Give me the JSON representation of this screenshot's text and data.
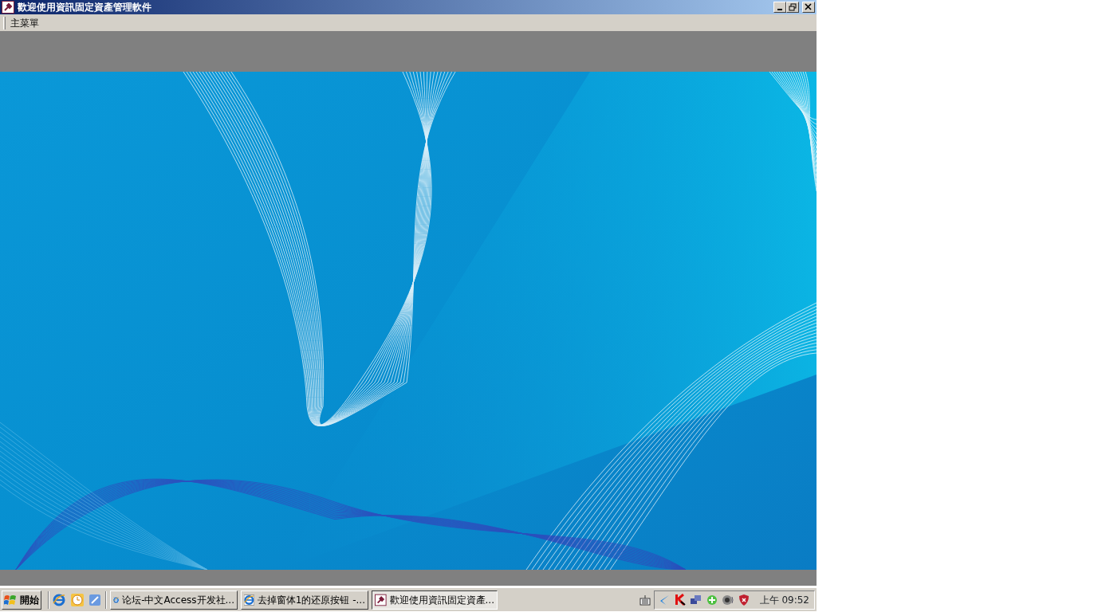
{
  "window": {
    "title": "歡迎使用資訊固定資產管理軟件"
  },
  "menu_bar": {
    "items": [
      {
        "label": "主菜單"
      }
    ]
  },
  "taskbar": {
    "start_label": "開始",
    "tasks": [
      {
        "label": "论坛-中文Access开发社...",
        "kind": "browser",
        "selected": false
      },
      {
        "label": "去掉窗体1的还原按钮 -...",
        "kind": "browser",
        "selected": false
      },
      {
        "label": "歡迎使用資訊固定資產...",
        "kind": "access",
        "selected": true
      }
    ],
    "clock": "上午 09:52"
  }
}
